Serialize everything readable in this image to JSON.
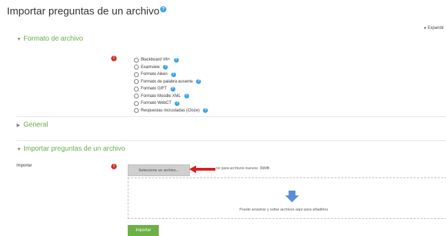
{
  "header": {
    "title": "Importar preguntas de un archivo",
    "help_icon": "question-circle-icon",
    "expand_all": "Expandir"
  },
  "sections": {
    "formato": {
      "label": "Formato de archivo",
      "expanded": true
    },
    "general": {
      "label": "General",
      "expanded": false
    },
    "importar": {
      "label": "Importar preguntas de un archivo",
      "expanded": true
    }
  },
  "format_options": [
    "Blackboard V6+",
    "Examview",
    "Formato Aiken",
    "Formato de palabra ausente",
    "Formato GIFT",
    "Formato Moodle XML",
    "Formato WebCT",
    "Respuestas incrustadas (Cloze)"
  ],
  "required_icon": "exclamation-circle-icon",
  "import_field": {
    "label": "Importar",
    "choose_file_label": "Seleccione un archivo...",
    "max_size_text": "no para archivos nuevos: 30MB",
    "drop_text": "Puede arrastrar y soltar archivos aquí para añadirlos",
    "drop_icon": "down-arrow-icon"
  },
  "colors": {
    "section_green": "#68a94a",
    "button_green": "#6cb046",
    "help_blue": "#3aa3e3",
    "required_red": "#c9302c",
    "arrow_blue": "#5b8ed6",
    "annotation_red": "#d81e1e"
  },
  "submit_label": "Importar"
}
